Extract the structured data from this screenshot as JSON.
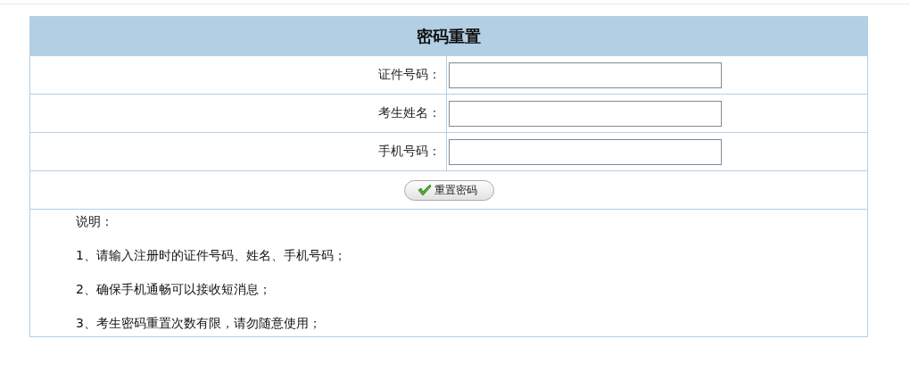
{
  "title": "密码重置",
  "fields": [
    {
      "label": "证件号码："
    },
    {
      "label": "考生姓名："
    },
    {
      "label": "手机号码："
    }
  ],
  "submit_button": "重置密码",
  "notes_heading": "说明：",
  "notes": [
    "1、请输入注册时的证件号码、姓名、手机号码；",
    "2、确保手机通畅可以接收短消息；",
    "3、考生密码重置次数有限，请勿随意使用；"
  ]
}
